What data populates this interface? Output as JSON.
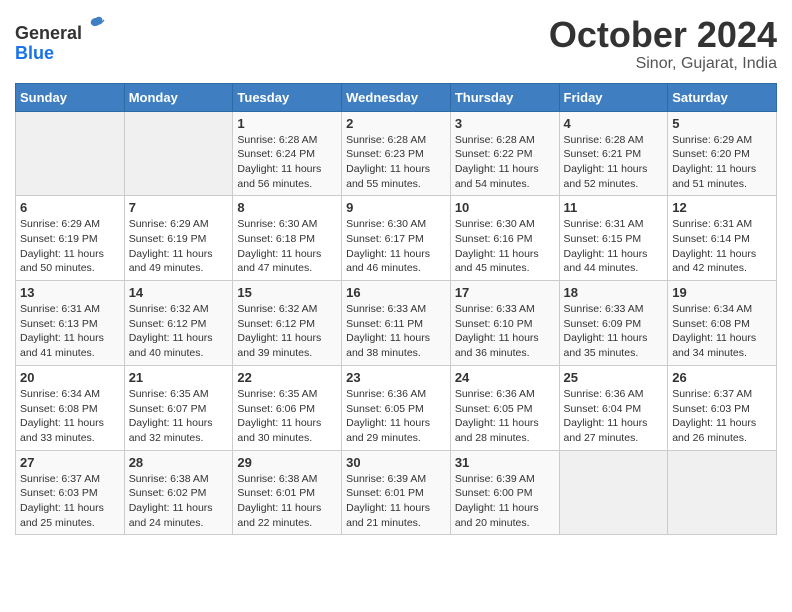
{
  "logo": {
    "text_general": "General",
    "text_blue": "Blue"
  },
  "title": {
    "month": "October 2024",
    "location": "Sinor, Gujarat, India"
  },
  "calendar": {
    "headers": [
      "Sunday",
      "Monday",
      "Tuesday",
      "Wednesday",
      "Thursday",
      "Friday",
      "Saturday"
    ],
    "weeks": [
      [
        {
          "day": "",
          "sunrise": "",
          "sunset": "",
          "daylight": ""
        },
        {
          "day": "",
          "sunrise": "",
          "sunset": "",
          "daylight": ""
        },
        {
          "day": "1",
          "sunrise": "Sunrise: 6:28 AM",
          "sunset": "Sunset: 6:24 PM",
          "daylight": "Daylight: 11 hours and 56 minutes."
        },
        {
          "day": "2",
          "sunrise": "Sunrise: 6:28 AM",
          "sunset": "Sunset: 6:23 PM",
          "daylight": "Daylight: 11 hours and 55 minutes."
        },
        {
          "day": "3",
          "sunrise": "Sunrise: 6:28 AM",
          "sunset": "Sunset: 6:22 PM",
          "daylight": "Daylight: 11 hours and 54 minutes."
        },
        {
          "day": "4",
          "sunrise": "Sunrise: 6:28 AM",
          "sunset": "Sunset: 6:21 PM",
          "daylight": "Daylight: 11 hours and 52 minutes."
        },
        {
          "day": "5",
          "sunrise": "Sunrise: 6:29 AM",
          "sunset": "Sunset: 6:20 PM",
          "daylight": "Daylight: 11 hours and 51 minutes."
        }
      ],
      [
        {
          "day": "6",
          "sunrise": "Sunrise: 6:29 AM",
          "sunset": "Sunset: 6:19 PM",
          "daylight": "Daylight: 11 hours and 50 minutes."
        },
        {
          "day": "7",
          "sunrise": "Sunrise: 6:29 AM",
          "sunset": "Sunset: 6:19 PM",
          "daylight": "Daylight: 11 hours and 49 minutes."
        },
        {
          "day": "8",
          "sunrise": "Sunrise: 6:30 AM",
          "sunset": "Sunset: 6:18 PM",
          "daylight": "Daylight: 11 hours and 47 minutes."
        },
        {
          "day": "9",
          "sunrise": "Sunrise: 6:30 AM",
          "sunset": "Sunset: 6:17 PM",
          "daylight": "Daylight: 11 hours and 46 minutes."
        },
        {
          "day": "10",
          "sunrise": "Sunrise: 6:30 AM",
          "sunset": "Sunset: 6:16 PM",
          "daylight": "Daylight: 11 hours and 45 minutes."
        },
        {
          "day": "11",
          "sunrise": "Sunrise: 6:31 AM",
          "sunset": "Sunset: 6:15 PM",
          "daylight": "Daylight: 11 hours and 44 minutes."
        },
        {
          "day": "12",
          "sunrise": "Sunrise: 6:31 AM",
          "sunset": "Sunset: 6:14 PM",
          "daylight": "Daylight: 11 hours and 42 minutes."
        }
      ],
      [
        {
          "day": "13",
          "sunrise": "Sunrise: 6:31 AM",
          "sunset": "Sunset: 6:13 PM",
          "daylight": "Daylight: 11 hours and 41 minutes."
        },
        {
          "day": "14",
          "sunrise": "Sunrise: 6:32 AM",
          "sunset": "Sunset: 6:12 PM",
          "daylight": "Daylight: 11 hours and 40 minutes."
        },
        {
          "day": "15",
          "sunrise": "Sunrise: 6:32 AM",
          "sunset": "Sunset: 6:12 PM",
          "daylight": "Daylight: 11 hours and 39 minutes."
        },
        {
          "day": "16",
          "sunrise": "Sunrise: 6:33 AM",
          "sunset": "Sunset: 6:11 PM",
          "daylight": "Daylight: 11 hours and 38 minutes."
        },
        {
          "day": "17",
          "sunrise": "Sunrise: 6:33 AM",
          "sunset": "Sunset: 6:10 PM",
          "daylight": "Daylight: 11 hours and 36 minutes."
        },
        {
          "day": "18",
          "sunrise": "Sunrise: 6:33 AM",
          "sunset": "Sunset: 6:09 PM",
          "daylight": "Daylight: 11 hours and 35 minutes."
        },
        {
          "day": "19",
          "sunrise": "Sunrise: 6:34 AM",
          "sunset": "Sunset: 6:08 PM",
          "daylight": "Daylight: 11 hours and 34 minutes."
        }
      ],
      [
        {
          "day": "20",
          "sunrise": "Sunrise: 6:34 AM",
          "sunset": "Sunset: 6:08 PM",
          "daylight": "Daylight: 11 hours and 33 minutes."
        },
        {
          "day": "21",
          "sunrise": "Sunrise: 6:35 AM",
          "sunset": "Sunset: 6:07 PM",
          "daylight": "Daylight: 11 hours and 32 minutes."
        },
        {
          "day": "22",
          "sunrise": "Sunrise: 6:35 AM",
          "sunset": "Sunset: 6:06 PM",
          "daylight": "Daylight: 11 hours and 30 minutes."
        },
        {
          "day": "23",
          "sunrise": "Sunrise: 6:36 AM",
          "sunset": "Sunset: 6:05 PM",
          "daylight": "Daylight: 11 hours and 29 minutes."
        },
        {
          "day": "24",
          "sunrise": "Sunrise: 6:36 AM",
          "sunset": "Sunset: 6:05 PM",
          "daylight": "Daylight: 11 hours and 28 minutes."
        },
        {
          "day": "25",
          "sunrise": "Sunrise: 6:36 AM",
          "sunset": "Sunset: 6:04 PM",
          "daylight": "Daylight: 11 hours and 27 minutes."
        },
        {
          "day": "26",
          "sunrise": "Sunrise: 6:37 AM",
          "sunset": "Sunset: 6:03 PM",
          "daylight": "Daylight: 11 hours and 26 minutes."
        }
      ],
      [
        {
          "day": "27",
          "sunrise": "Sunrise: 6:37 AM",
          "sunset": "Sunset: 6:03 PM",
          "daylight": "Daylight: 11 hours and 25 minutes."
        },
        {
          "day": "28",
          "sunrise": "Sunrise: 6:38 AM",
          "sunset": "Sunset: 6:02 PM",
          "daylight": "Daylight: 11 hours and 24 minutes."
        },
        {
          "day": "29",
          "sunrise": "Sunrise: 6:38 AM",
          "sunset": "Sunset: 6:01 PM",
          "daylight": "Daylight: 11 hours and 22 minutes."
        },
        {
          "day": "30",
          "sunrise": "Sunrise: 6:39 AM",
          "sunset": "Sunset: 6:01 PM",
          "daylight": "Daylight: 11 hours and 21 minutes."
        },
        {
          "day": "31",
          "sunrise": "Sunrise: 6:39 AM",
          "sunset": "Sunset: 6:00 PM",
          "daylight": "Daylight: 11 hours and 20 minutes."
        },
        {
          "day": "",
          "sunrise": "",
          "sunset": "",
          "daylight": ""
        },
        {
          "day": "",
          "sunrise": "",
          "sunset": "",
          "daylight": ""
        }
      ]
    ]
  }
}
